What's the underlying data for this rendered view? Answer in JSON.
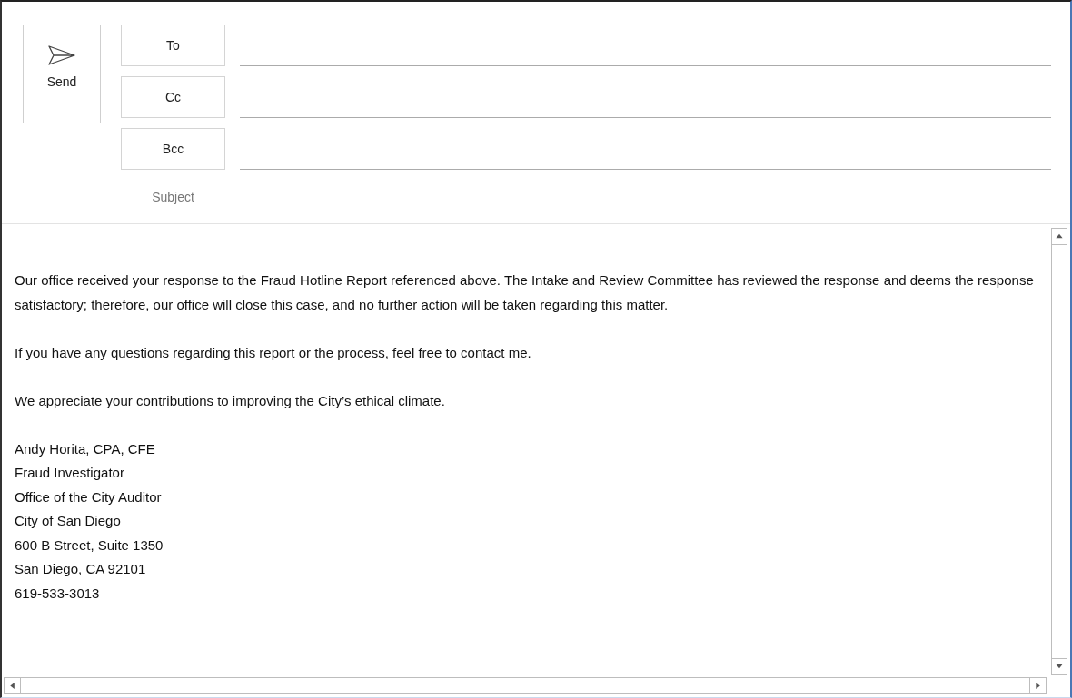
{
  "send_button": {
    "label": "Send"
  },
  "recipient_buttons": [
    {
      "label": "To"
    },
    {
      "label": "Cc"
    },
    {
      "label": "Bcc"
    }
  ],
  "subject": {
    "label": "Subject"
  },
  "body": {
    "paragraphs": [
      "Our office received your response to the Fraud Hotline Report referenced above. The Intake and Review Committee has reviewed the response and deems the response satisfactory; therefore, our office will close this case, and no further action will be taken regarding this matter.",
      "If you have any questions regarding this report or the process, feel free to contact me.",
      "We appreciate your contributions to improving the City’s ethical climate."
    ],
    "signature": [
      "Andy Horita, CPA, CFE",
      "Fraud Investigator",
      "Office of the City Auditor",
      "City of San Diego",
      "600 B Street, Suite 1350",
      "San Diego, CA 92101",
      "619-533-3013"
    ]
  }
}
